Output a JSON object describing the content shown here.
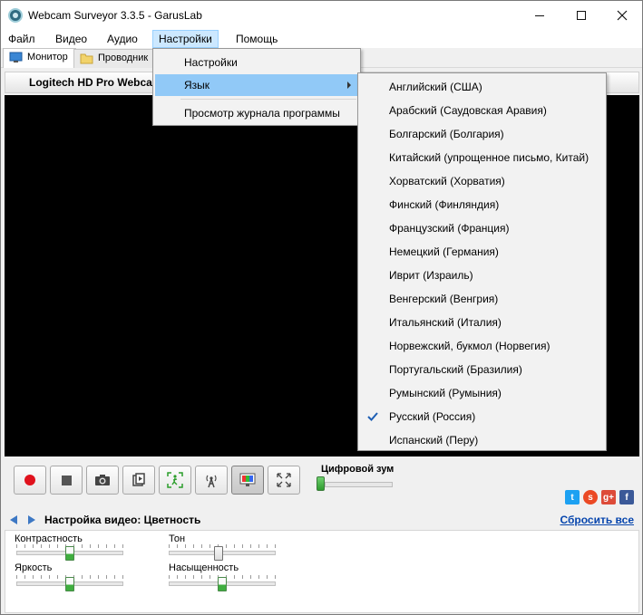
{
  "window": {
    "title": "Webcam Surveyor 3.3.5 - GarusLab"
  },
  "menubar": {
    "items": [
      "Файл",
      "Видео",
      "Аудио",
      "Настройки",
      "Помощь"
    ],
    "active": "Настройки"
  },
  "tabs": [
    {
      "label": "Монитор",
      "icon": "monitor-icon",
      "selected": true
    },
    {
      "label": "Проводник",
      "icon": "folder-icon",
      "selected": false
    }
  ],
  "camera": {
    "title": "Logitech HD Pro Webcam C920"
  },
  "settings_menu": {
    "items": [
      "Настройки",
      "Язык",
      "Просмотр журнала программы"
    ],
    "highlighted": "Язык"
  },
  "language_menu": {
    "items": [
      "Английский (США)",
      "Арабский (Саудовская Аравия)",
      "Болгарский (Болгария)",
      "Китайский (упрощенное письмо, Китай)",
      "Хорватский (Хорватия)",
      "Финский (Финляндия)",
      "Французский (Франция)",
      "Немецкий (Германия)",
      "Иврит (Израиль)",
      "Венгерский (Венгрия)",
      "Итальянский (Италия)",
      "Норвежский, букмол (Норвегия)",
      "Португальский (Бразилия)",
      "Румынский (Румыния)",
      "Русский (Россия)",
      "Испанский (Перу)"
    ],
    "checked": "Русский (Россия)"
  },
  "controls": {
    "buttons": [
      "record-icon",
      "stop-icon",
      "camera-icon",
      "playback-icon",
      "motion-detect-icon",
      "broadcast-icon",
      "color-settings-icon",
      "fullscreen-icon"
    ],
    "pressed": "color-settings-icon",
    "digital_zoom_label": "Цифровой зум",
    "digital_zoom_value": 0
  },
  "social": [
    "twitter-icon",
    "stumbleupon-icon",
    "googleplus-icon",
    "facebook-icon"
  ],
  "settings_panel": {
    "title": "Настройка видео: Цветность",
    "reset_label": "Сбросить все",
    "sliders": [
      {
        "label": "Контрастность",
        "value": 0.5
      },
      {
        "label": "Тон",
        "value": 0.5
      },
      {
        "label": "Яркость",
        "value": 0.5
      },
      {
        "label": "Насыщенность",
        "value": 0.5
      }
    ]
  },
  "colors": {
    "menu_highlight": "#91c9f7",
    "active_menu_bg": "#cce8ff",
    "link": "#0645ad",
    "record": "#e0121d"
  }
}
